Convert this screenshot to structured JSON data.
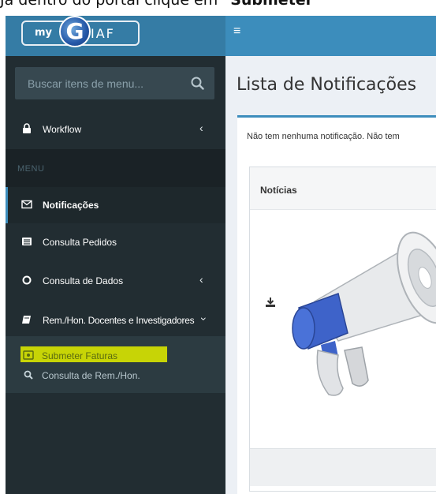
{
  "caption": {
    "prefix": "Já dentro do portal clique em ",
    "bold": "\"Submeter"
  },
  "logo": {
    "my": "my",
    "g": "G",
    "iaf": "IAF"
  },
  "topbar": {
    "menu_toggle": "≡"
  },
  "sidebar": {
    "search": {
      "placeholder": "Buscar itens de menu..."
    },
    "items": [
      {
        "label": "Workflow",
        "icon": "lock-icon",
        "has_caret": true
      },
      {
        "label": "Notificações",
        "icon": "envelope-icon",
        "active": true
      },
      {
        "label": "Consulta Pedidos",
        "icon": "list-icon"
      },
      {
        "label": "Consulta de Dados",
        "icon": "circle-icon",
        "has_caret": true
      },
      {
        "label": "Rem./Hon. Docentes e Investigadores",
        "icon": "book-icon",
        "has_caret": true
      }
    ],
    "header": "MENU",
    "submenu": [
      {
        "label": "Submeter Faturas",
        "icon": "money-icon",
        "highlighted": true
      },
      {
        "label": "Consulta de Rem./Hon.",
        "icon": "search-icon"
      }
    ]
  },
  "content": {
    "page_title": "Lista de Notificações",
    "notice": "Não tem nenhuma notificação.  Não tem",
    "news": {
      "title": "Notícias"
    }
  },
  "colors": {
    "topbar": "#3c8dbc",
    "logo_bg": "#357ca5",
    "sidebar": "#222d32",
    "highlight": "#d8e600"
  }
}
